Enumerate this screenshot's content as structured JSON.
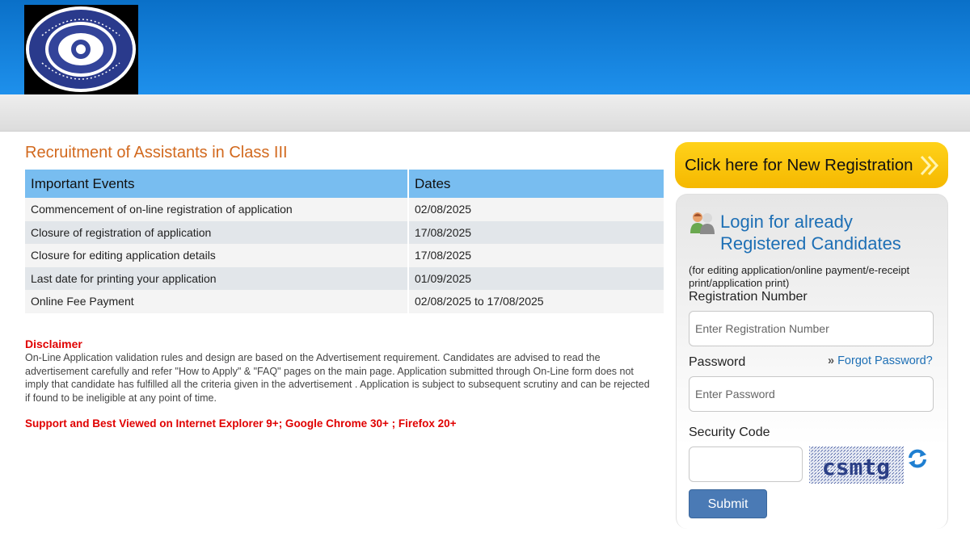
{
  "header": {
    "logo_text": "THE ORIENTAL INSURANCE COMPANY LIMITED"
  },
  "page_title": "Recruitment of Assistants in Class III",
  "events_table": {
    "headers": [
      "Important Events",
      "Dates"
    ],
    "rows": [
      [
        "Commencement of on-line registration of application",
        "02/08/2025"
      ],
      [
        "Closure of registration of application",
        "17/08/2025"
      ],
      [
        "Closure for editing application details",
        "17/08/2025"
      ],
      [
        "Last date for printing your application",
        "01/09/2025"
      ],
      [
        "Online Fee Payment",
        "02/08/2025 to 17/08/2025"
      ]
    ]
  },
  "disclaimer": {
    "title": "Disclaimer",
    "text": "On-Line Application validation rules and design are based on the Advertisement requirement. Candidates are advised to read the advertisement carefully and refer \"How to Apply\" & \"FAQ\" pages on the main page. Application submitted through On-Line form does not imply that candidate has fulfilled all the criteria given in the advertisement . Application is subject to subsequent scrutiny and can be rejected if found to be ineligible at any point of time."
  },
  "support_text": "Support and Best Viewed on Internet Explorer 9+; Google Chrome 30+ ; Firefox 20+",
  "new_registration": {
    "label": "Click here for New Registration",
    "icon": "double-chevron-right-icon"
  },
  "login": {
    "title": "Login for already Registered Candidates",
    "note": "(for editing application/online payment/e-receipt print/application print)",
    "reg_label": "Registration Number",
    "reg_placeholder": "Enter Registration Number",
    "reg_value": "",
    "password_label": "Password",
    "password_placeholder": "Enter Password",
    "password_value": "",
    "forgot_label": "Forgot Password?",
    "security_label": "Security Code",
    "security_value": "",
    "captcha_text": "csmtg",
    "submit_label": "Submit"
  },
  "colors": {
    "header_blue": "#1e90ec",
    "title_orange": "#d2691e",
    "table_header": "#78bdf0",
    "alert_red": "#e00000",
    "reg_button_yellow": "#ffd21a",
    "link_blue": "#1d6fb5",
    "submit_blue": "#4a7ab5"
  }
}
